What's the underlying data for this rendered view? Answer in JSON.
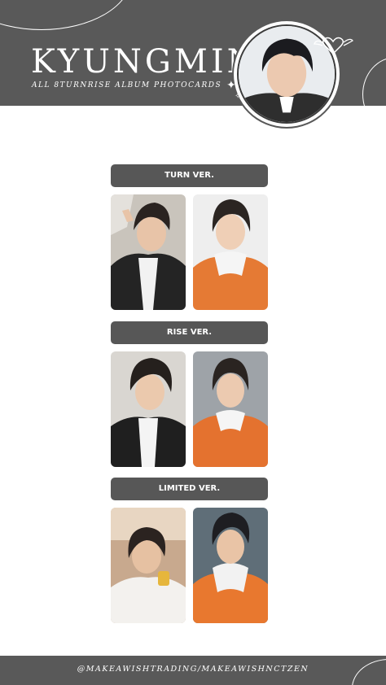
{
  "header": {
    "title": "KYUNGMIN",
    "subtitle": "ALL 8TURNRISE ALBUM PHOTOCARDS"
  },
  "sections": [
    {
      "label": "TURN VER."
    },
    {
      "label": "RISE VER."
    },
    {
      "label": "LIMITED VER."
    }
  ],
  "footer": {
    "handle": "@MAKEAWISHTRADING/MAKEAWISHNCTZEN"
  },
  "colors": {
    "banner": "#595959",
    "section_bar": "#575757",
    "background": "#ffffff"
  },
  "icons": [
    "sparkle-icon",
    "winged-heart-icon"
  ]
}
